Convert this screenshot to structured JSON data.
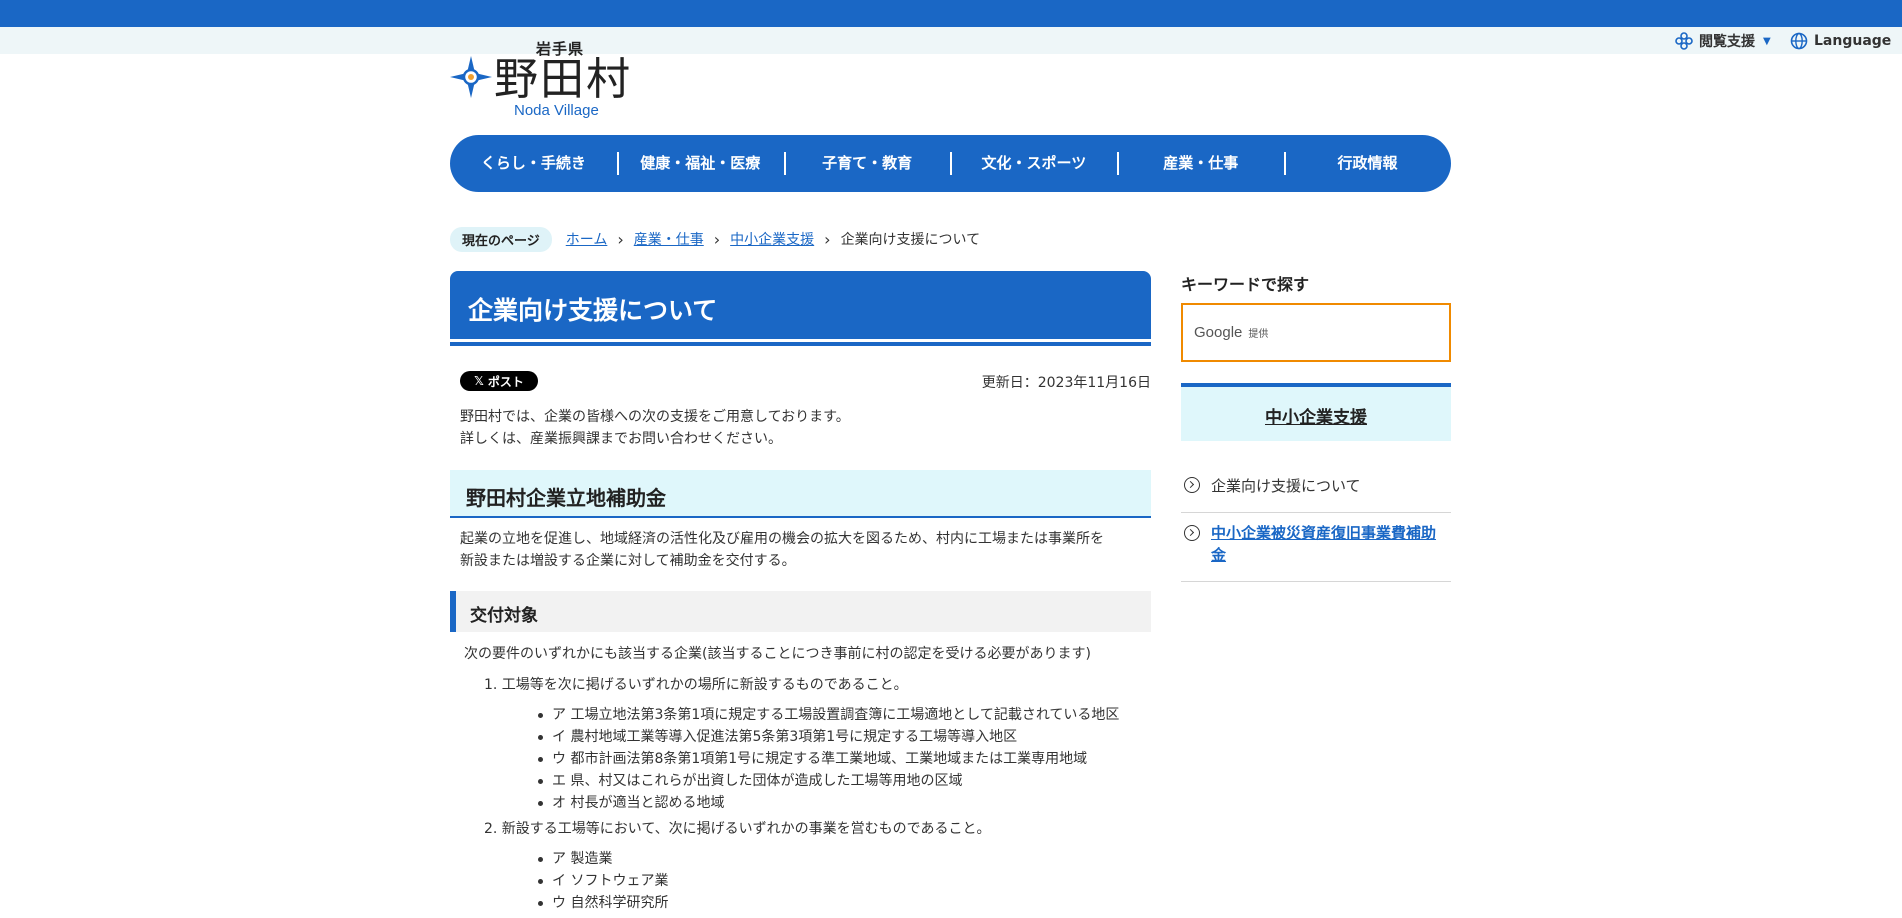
{
  "header": {
    "prefecture": "岩手県",
    "village_name": "野田村",
    "village_en": "Noda Village",
    "utility": {
      "access_label": "閲覧支援",
      "language_label": "Language"
    }
  },
  "nav": {
    "items": [
      "くらし・手続き",
      "健康・福祉・医療",
      "子育て・教育",
      "文化・スポーツ",
      "産業・仕事",
      "行政情報"
    ]
  },
  "breadcrumb": {
    "label": "現在のページ",
    "links": [
      "ホーム",
      "産業・仕事",
      "中小企業支援"
    ],
    "current": "企業向け支援について"
  },
  "main": {
    "title": "企業向け支援について",
    "post_label": "ポスト",
    "updated": "更新日：2023年11月16日",
    "intro": [
      "野田村では、企業の皆様への次の支援をご用意しております。",
      "詳しくは、産業振興課までお問い合わせください。"
    ],
    "section_title": "野田村企業立地補助金",
    "section_text": [
      " 起業の立地を促進し、地域経済の活性化及び雇用の機会の拡大を図るため、村内に工場または事業所を",
      "新設または増設する企業に対して補助金を交付する。"
    ],
    "subsection_title": "交付対象",
    "subsection_text": "次の要件のいずれかにも該当する企業(該当することにつき事前に村の認定を受ける必要があります)",
    "list": [
      {
        "text": "1. 工場等を次に掲げるいずれかの場所に新設するものであること。",
        "items": [
          "ア 工場立地法第3条第1項に規定する工場設置調査簿に工場適地として記載されている地区",
          "イ 農村地域工業等導入促進法第5条第3項第1号に規定する工場等導入地区",
          "ウ 都市計画法第8条第1項第1号に規定する準工業地域、工業地域または工業専用地域",
          "エ 県、村又はこれらが出資した団体が造成した工場等用地の区域",
          "オ 村長が適当と認める地域"
        ]
      },
      {
        "text": "2. 新設する工場等において、次に掲げるいずれかの事業を営むものであること。",
        "items": [
          "ア 製造業",
          "イ ソフトウェア業",
          "ウ 自然科学研究所"
        ]
      }
    ]
  },
  "sidebar": {
    "search_title": "キーワードで探す",
    "google_label": "Google",
    "provided_label": "提供",
    "category_title": "中小企業支援",
    "links": [
      "企業向け支援について",
      "中小企業被災資産復旧事業費補助金"
    ]
  },
  "colors": {
    "primary": "#1a67c5",
    "light": "#dff7fb",
    "search_border": "#f08a00"
  }
}
